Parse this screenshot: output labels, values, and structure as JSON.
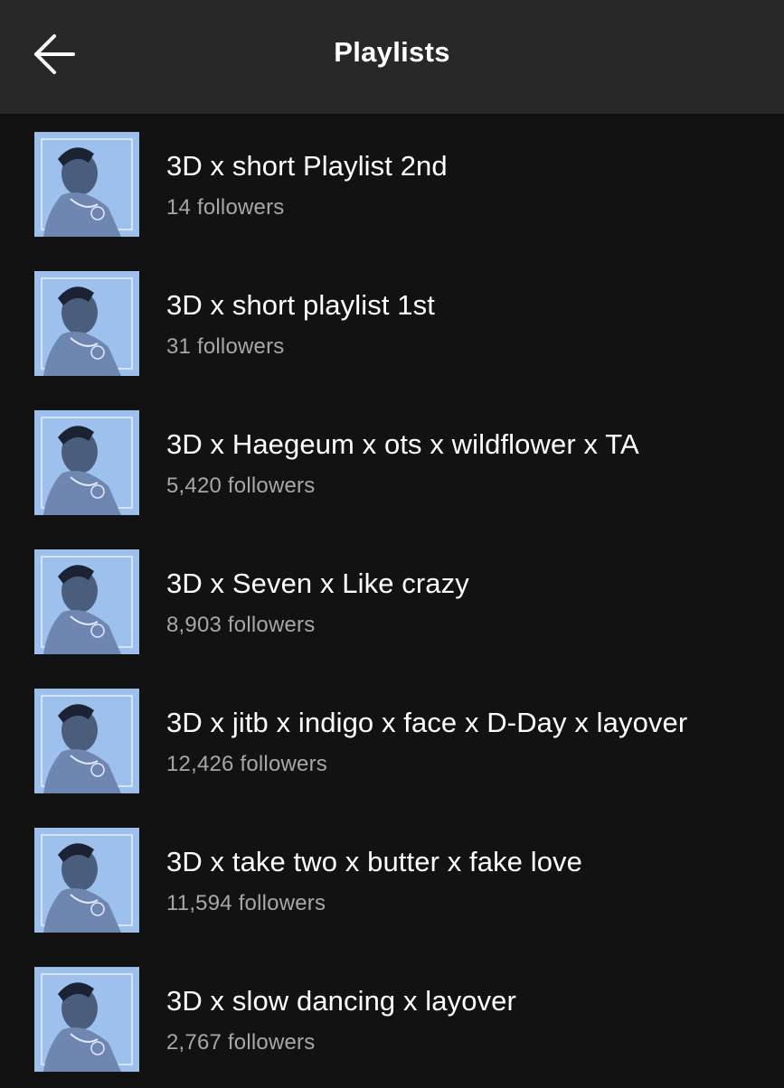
{
  "header": {
    "title": "Playlists"
  },
  "icons": {
    "back": "arrow-left-icon"
  },
  "colors": {
    "background": "#121212",
    "header": "#282828",
    "text_primary": "#ffffff",
    "text_secondary": "#a7a7a7"
  },
  "playlists": [
    {
      "title": "3D x short Playlist 2nd",
      "followers": "14 followers"
    },
    {
      "title": "3D x short playlist 1st",
      "followers": "31 followers"
    },
    {
      "title": "3D x Haegeum x ots x wildflower x TA",
      "followers": "5,420 followers"
    },
    {
      "title": "3D x Seven x Like crazy",
      "followers": "8,903 followers"
    },
    {
      "title": "3D x jitb x indigo x face x D-Day x layover",
      "followers": "12,426 followers"
    },
    {
      "title": "3D x take two x butter x fake love",
      "followers": "11,594 followers"
    },
    {
      "title": "3D x slow dancing x layover",
      "followers": "2,767 followers"
    }
  ]
}
